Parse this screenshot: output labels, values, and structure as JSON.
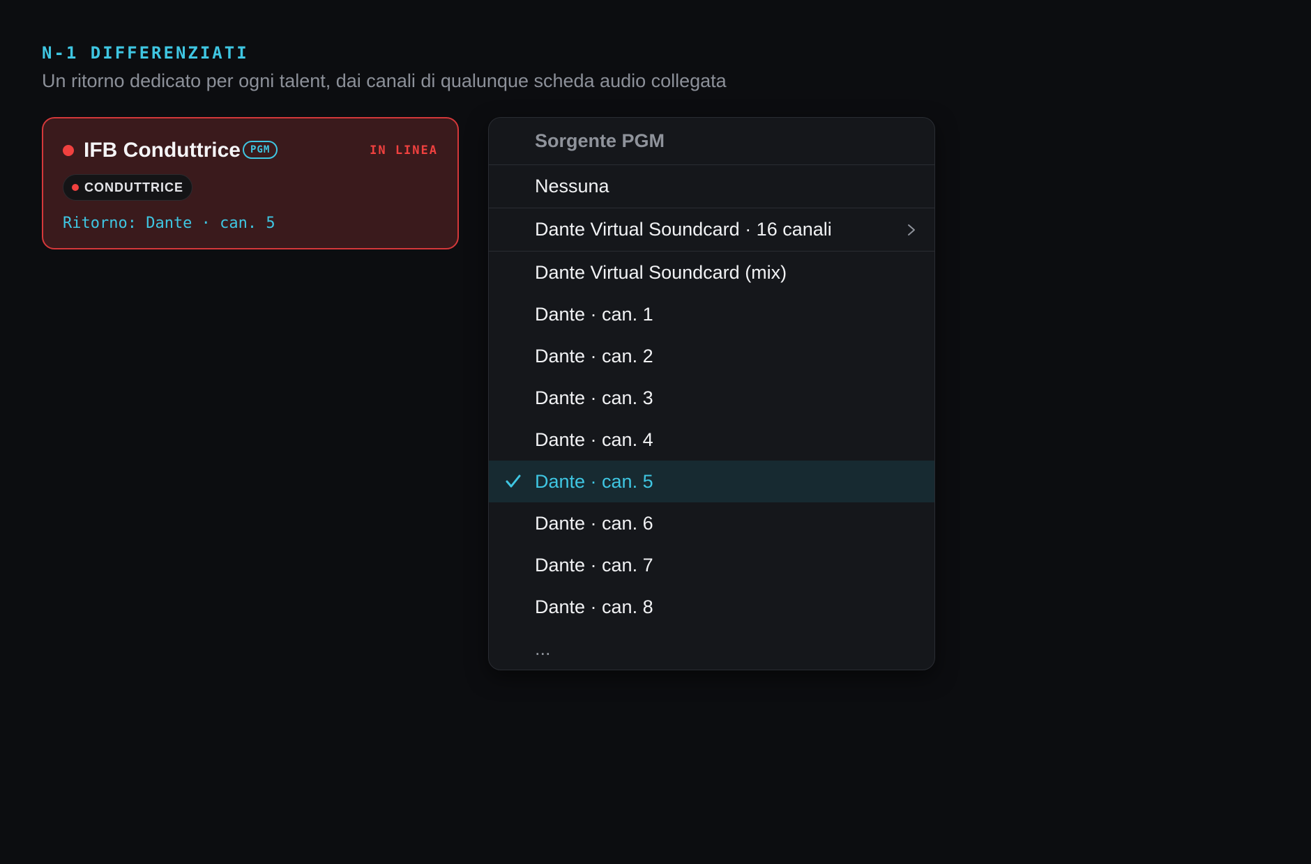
{
  "section": {
    "title": "N-1 DIFFERENZIATI",
    "subtitle": "Un ritorno dedicato per ogni talent, dai canali di qualunque scheda audio collegata"
  },
  "card": {
    "title": "IFB Conduttrice",
    "badge": "PGM",
    "status": "IN LINEA",
    "role": "CONDUTTRICE",
    "return": "Ritorno: Dante · can. 5",
    "colors": {
      "accent": "#3fc6e2",
      "live": "#f0413f",
      "border": "#d4383a",
      "background": "#3a1a1c"
    }
  },
  "menu": {
    "header": "Sorgente PGM",
    "none": "Nessuna",
    "device": {
      "label": "Dante Virtual Soundcard · 16 canali",
      "icon": "chevron-right-icon"
    },
    "items": [
      {
        "label": "Dante Virtual Soundcard (mix)",
        "selected": false
      },
      {
        "label": "Dante · can. 1",
        "selected": false
      },
      {
        "label": "Dante · can. 2",
        "selected": false
      },
      {
        "label": "Dante · can. 3",
        "selected": false
      },
      {
        "label": "Dante · can. 4",
        "selected": false
      },
      {
        "label": "Dante · can. 5",
        "selected": true
      },
      {
        "label": "Dante · can. 6",
        "selected": false
      },
      {
        "label": "Dante · can. 7",
        "selected": false
      },
      {
        "label": "Dante · can. 8",
        "selected": false
      }
    ],
    "more": "...",
    "selected_icon": "check-icon"
  }
}
